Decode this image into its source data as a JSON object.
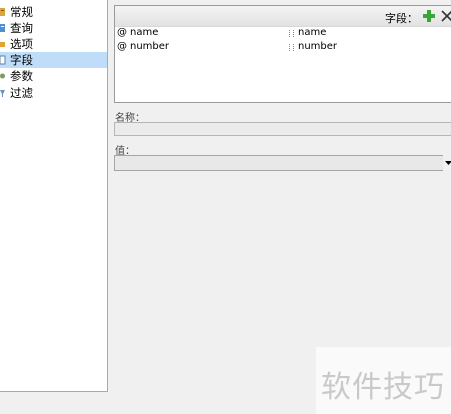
{
  "nav": {
    "items": [
      {
        "label": "常规",
        "icon": "general-icon"
      },
      {
        "label": "查询",
        "icon": "query-icon"
      },
      {
        "label": "选项",
        "icon": "options-icon"
      },
      {
        "label": "字段",
        "icon": "fields-icon",
        "selected": true
      },
      {
        "label": "参数",
        "icon": "params-icon"
      },
      {
        "label": "过滤",
        "icon": "filter-icon"
      }
    ]
  },
  "fields_panel": {
    "header_label": "字段：",
    "add_icon": "plus-icon",
    "remove_icon": "close-icon",
    "rows": [
      {
        "type_icon": "@",
        "name": "name",
        "alias": "name"
      },
      {
        "type_icon": "@",
        "name": "number",
        "alias": "number"
      }
    ]
  },
  "form": {
    "name_label": "名称：",
    "name_value": "",
    "value_label": "值：",
    "value_value": ""
  },
  "watermark": {
    "text": "软件技巧"
  },
  "colors": {
    "selection": "#bfdcf8",
    "nav_border": "#7fb4e8",
    "plus_green": "#3aa63a"
  }
}
